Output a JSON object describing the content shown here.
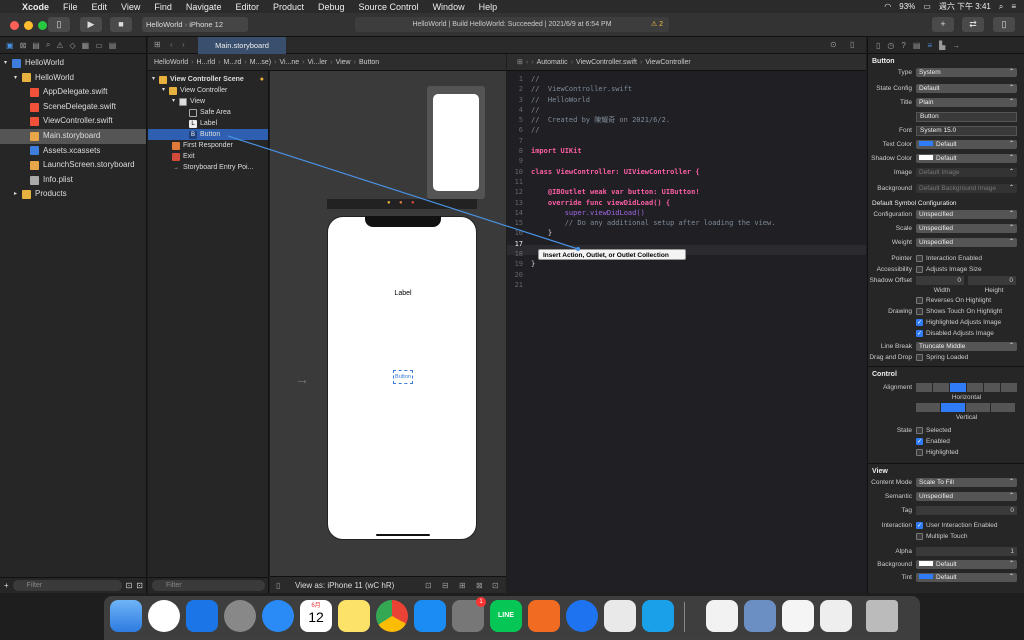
{
  "menubar": {
    "app": "Xcode",
    "items": [
      "File",
      "Edit",
      "View",
      "Find",
      "Navigate",
      "Editor",
      "Product",
      "Debug",
      "Source Control",
      "Window",
      "Help"
    ],
    "battery": "93%",
    "clock": "週六 下午 3:41"
  },
  "toolbar": {
    "scheme_project": "HelloWorld",
    "scheme_device": "iPhone 12",
    "status": "HelloWorld | Build HelloWorld: Succeeded | 2021/6/9 at 6:54 PM",
    "warnings": "2"
  },
  "navigator": {
    "project": "HelloWorld",
    "group": "HelloWorld",
    "files": [
      "AppDelegate.swift",
      "SceneDelegate.swift",
      "ViewController.swift",
      "Main.storyboard",
      "Assets.xcassets",
      "LaunchScreen.storyboard",
      "Info.plist"
    ],
    "products": "Products",
    "filter_placeholder": "Filter"
  },
  "storyboard_tab": "Main.storyboard",
  "jumpbar_left": [
    "HelloWorld",
    "H...rld",
    "M...rd",
    "M...se)",
    "Vi...ne",
    "Vi...ler",
    "View",
    "Button"
  ],
  "outline": {
    "scene": "View Controller Scene",
    "items": [
      "View Controller",
      "View",
      "Safe Area",
      "Label",
      "Button",
      "First Responder",
      "Exit",
      "Storyboard Entry Poi..."
    ],
    "filter_placeholder": "Filter"
  },
  "canvas": {
    "label_text": "Label",
    "button_text": "Button",
    "view_as": "View as: iPhone 11 (wC hR)"
  },
  "jumpbar_right": [
    "Automatic",
    "ViewController.swift",
    "ViewController"
  ],
  "code": {
    "lines": [
      {
        "n": "1",
        "t": "//"
      },
      {
        "n": "2",
        "t": "//  ViewController.swift"
      },
      {
        "n": "3",
        "t": "//  HelloWorld"
      },
      {
        "n": "4",
        "t": "//"
      },
      {
        "n": "5",
        "t": "//  Created by 陳耀奇 on 2021/6/2."
      },
      {
        "n": "6",
        "t": "//"
      },
      {
        "n": "7",
        "t": ""
      },
      {
        "n": "8",
        "t": "import UIKit"
      },
      {
        "n": "9",
        "t": ""
      },
      {
        "n": "10",
        "t": "class ViewController: UIViewController {"
      },
      {
        "n": "11",
        "t": ""
      },
      {
        "n": "12",
        "t": "    @IBOutlet weak var button: UIButton!"
      },
      {
        "n": "13",
        "t": "    override func viewDidLoad() {"
      },
      {
        "n": "14",
        "t": "        super.viewDidLoad()"
      },
      {
        "n": "15",
        "t": "        // Do any additional setup after loading the view."
      },
      {
        "n": "16",
        "t": "    }"
      },
      {
        "n": "17",
        "t": ""
      },
      {
        "n": "18",
        "t": ""
      },
      {
        "n": "19",
        "t": "}"
      },
      {
        "n": "20",
        "t": ""
      },
      {
        "n": "21",
        "t": ""
      }
    ],
    "tooltip": "Insert Action, Outlet, or Outlet Collection"
  },
  "inspector": {
    "header": "Button",
    "type": "System",
    "state_config": "Default",
    "title": "Plain",
    "title_text": "Button",
    "font": "System 15.0",
    "text_color": "Default",
    "shadow_color": "Default",
    "image_placeholder": "Default Image",
    "background_placeholder": "Default Background Image",
    "symbol_header": "Default Symbol Configuration",
    "configuration": "Unspecified",
    "scale": "Unspecified",
    "weight": "Unspecified",
    "pointer": "Interaction Enabled",
    "accessibility": "Adjusts Image Size",
    "shadow_offset_w": "0",
    "shadow_offset_h": "0",
    "width_lbl": "Width",
    "height_lbl": "Height",
    "drawing": [
      "Reverses On Highlight",
      "Shows Touch On Highlight",
      "Highlighted Adjusts Image",
      "Disabled Adjusts Image"
    ],
    "line_break": "Truncate Middle",
    "drag_drop": "Spring Loaded",
    "control_header": "Control",
    "horizontal": "Horizontal",
    "vertical": "Vertical",
    "state": [
      "Selected",
      "Enabled",
      "Highlighted"
    ],
    "view_header": "View",
    "content_mode": "Scale To Fill",
    "semantic": "Unspecified",
    "tag": "0",
    "interaction": [
      "User Interaction Enabled",
      "Multiple Touch"
    ],
    "alpha": "1",
    "background": "Default",
    "tint": "Default",
    "labels": {
      "type": "Type",
      "state_config": "State Config",
      "title": "Title",
      "font": "Font",
      "text_color": "Text Color",
      "shadow_color": "Shadow Color",
      "image": "Image",
      "background": "Background",
      "configuration": "Configuration",
      "scale": "Scale",
      "weight": "Weight",
      "pointer": "Pointer",
      "accessibility": "Accessibility",
      "shadow_offset": "Shadow Offset",
      "drawing": "Drawing",
      "line_break": "Line Break",
      "drag_drop": "Drag and Drop",
      "alignment": "Alignment",
      "state": "State",
      "content_mode": "Content Mode",
      "semantic": "Semantic",
      "tag": "Tag",
      "interaction": "Interaction",
      "alpha": "Alpha",
      "bg": "Background",
      "tint": "Tint"
    }
  },
  "dock": {
    "calendar_month": "6月",
    "calendar_day": "12",
    "line": "LINE",
    "badge": "1"
  },
  "colors": {
    "accent": "#2f7cf6",
    "selection": "#2e5fb0"
  }
}
